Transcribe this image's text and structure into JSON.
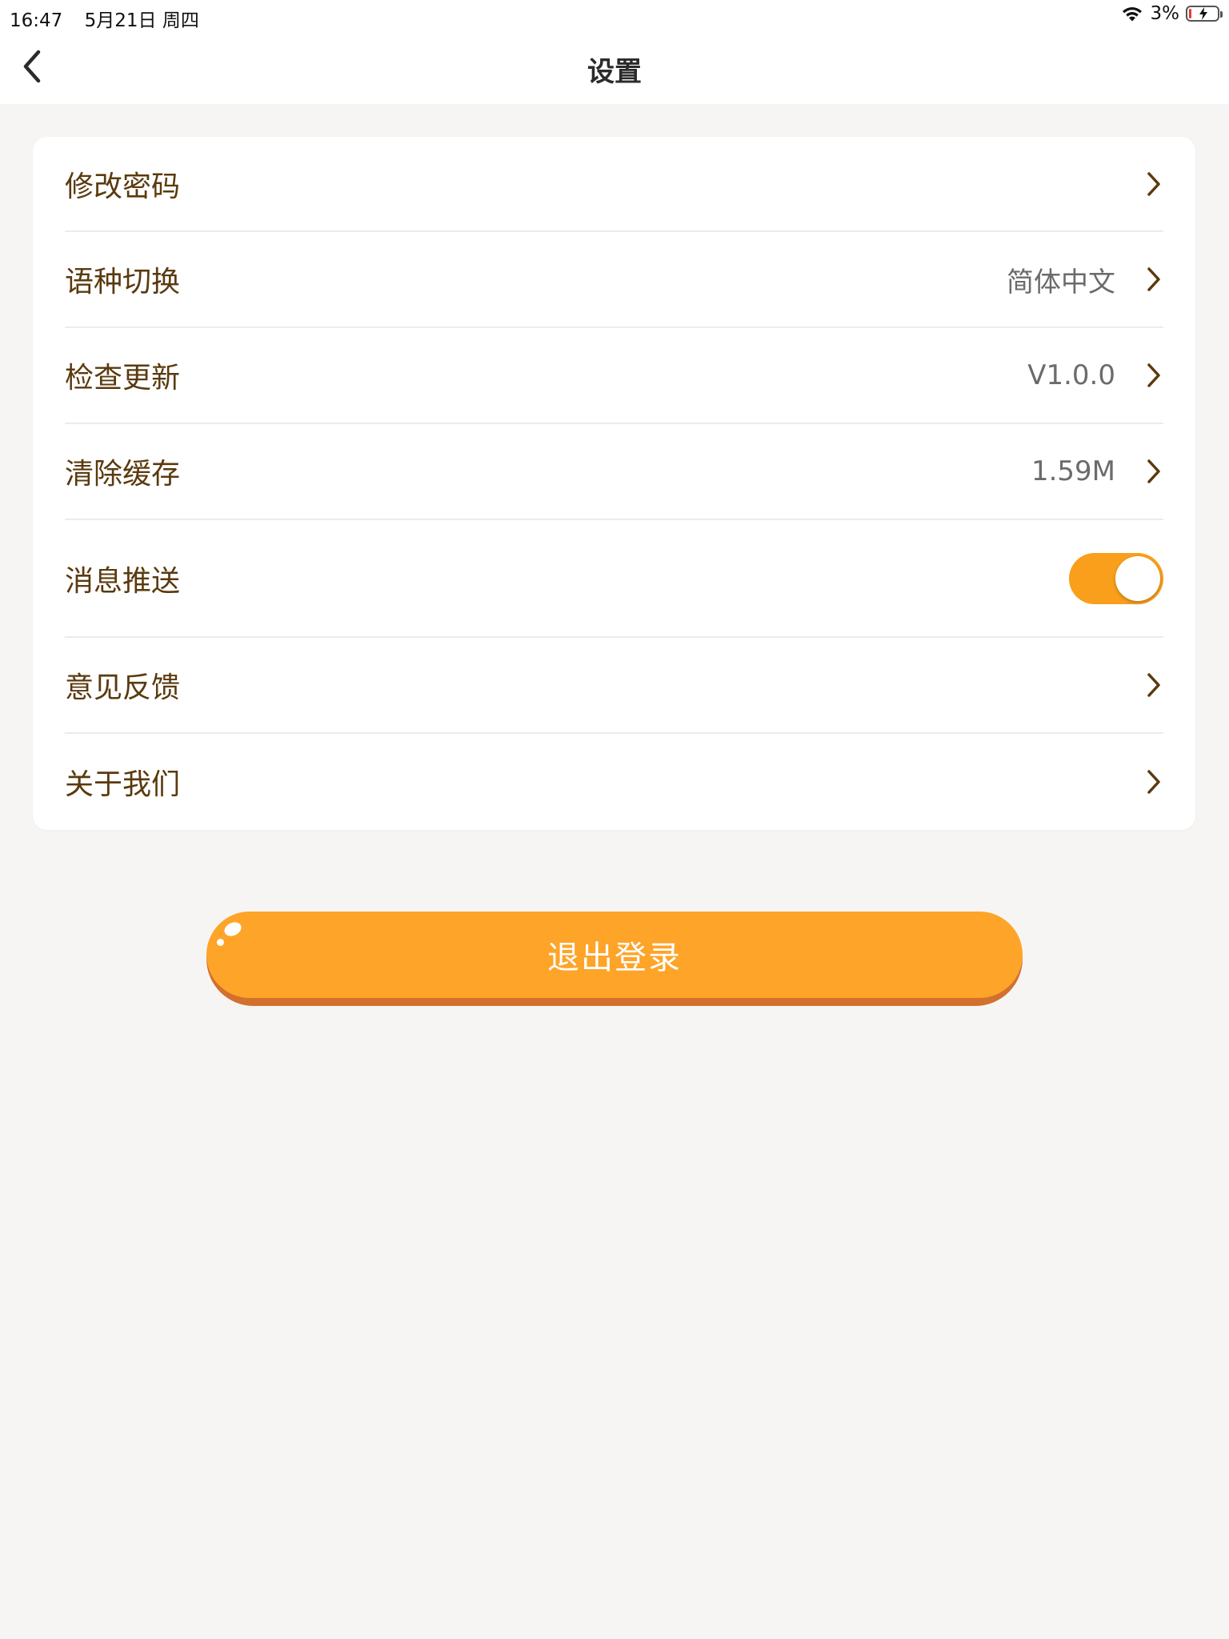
{
  "status_bar": {
    "time": "16:47",
    "date": "5月21日 周四",
    "battery_percent": "3%",
    "battery_level": 0.03,
    "icons": [
      "wifi-icon",
      "battery-icon",
      "charging-bolt-icon"
    ]
  },
  "nav": {
    "title": "设置",
    "back_icon": "chevron-left-icon"
  },
  "settings": {
    "items": [
      {
        "label": "修改密码",
        "value": "",
        "control": "chevron"
      },
      {
        "label": "语种切换",
        "value": "简体中文",
        "control": "chevron"
      },
      {
        "label": "检查更新",
        "value": "V1.0.0",
        "control": "chevron"
      },
      {
        "label": "清除缓存",
        "value": "1.59M",
        "control": "chevron"
      },
      {
        "label": "消息推送",
        "value": "",
        "control": "toggle",
        "toggle_on": true
      },
      {
        "label": "意见反馈",
        "value": "",
        "control": "chevron"
      },
      {
        "label": "关于我们",
        "value": "",
        "control": "chevron"
      }
    ]
  },
  "logout": {
    "label": "退出登录"
  },
  "colors": {
    "accent": "#f99f1b",
    "button": "#fea428",
    "button_shadow": "#d2702e",
    "label_text": "#5a3a0e",
    "value_text": "#6b6b6b",
    "page_background": "#f6f5f4"
  }
}
